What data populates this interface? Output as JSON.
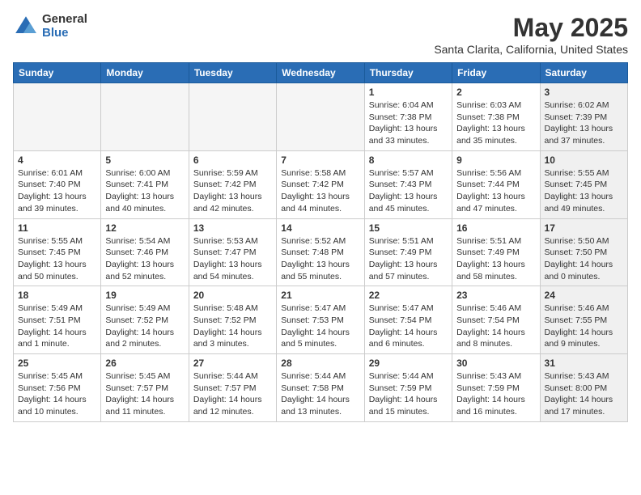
{
  "header": {
    "logo_general": "General",
    "logo_blue": "Blue",
    "month_title": "May 2025",
    "subtitle": "Santa Clarita, California, United States"
  },
  "days_of_week": [
    "Sunday",
    "Monday",
    "Tuesday",
    "Wednesday",
    "Thursday",
    "Friday",
    "Saturday"
  ],
  "weeks": [
    [
      {
        "day": "",
        "content": "",
        "shaded": true
      },
      {
        "day": "",
        "content": "",
        "shaded": true
      },
      {
        "day": "",
        "content": "",
        "shaded": true
      },
      {
        "day": "",
        "content": "",
        "shaded": true
      },
      {
        "day": "1",
        "content": "Sunrise: 6:04 AM\nSunset: 7:38 PM\nDaylight: 13 hours\nand 33 minutes.",
        "shaded": false
      },
      {
        "day": "2",
        "content": "Sunrise: 6:03 AM\nSunset: 7:38 PM\nDaylight: 13 hours\nand 35 minutes.",
        "shaded": false
      },
      {
        "day": "3",
        "content": "Sunrise: 6:02 AM\nSunset: 7:39 PM\nDaylight: 13 hours\nand 37 minutes.",
        "shaded": true
      }
    ],
    [
      {
        "day": "4",
        "content": "Sunrise: 6:01 AM\nSunset: 7:40 PM\nDaylight: 13 hours\nand 39 minutes.",
        "shaded": false
      },
      {
        "day": "5",
        "content": "Sunrise: 6:00 AM\nSunset: 7:41 PM\nDaylight: 13 hours\nand 40 minutes.",
        "shaded": false
      },
      {
        "day": "6",
        "content": "Sunrise: 5:59 AM\nSunset: 7:42 PM\nDaylight: 13 hours\nand 42 minutes.",
        "shaded": false
      },
      {
        "day": "7",
        "content": "Sunrise: 5:58 AM\nSunset: 7:42 PM\nDaylight: 13 hours\nand 44 minutes.",
        "shaded": false
      },
      {
        "day": "8",
        "content": "Sunrise: 5:57 AM\nSunset: 7:43 PM\nDaylight: 13 hours\nand 45 minutes.",
        "shaded": false
      },
      {
        "day": "9",
        "content": "Sunrise: 5:56 AM\nSunset: 7:44 PM\nDaylight: 13 hours\nand 47 minutes.",
        "shaded": false
      },
      {
        "day": "10",
        "content": "Sunrise: 5:55 AM\nSunset: 7:45 PM\nDaylight: 13 hours\nand 49 minutes.",
        "shaded": true
      }
    ],
    [
      {
        "day": "11",
        "content": "Sunrise: 5:55 AM\nSunset: 7:45 PM\nDaylight: 13 hours\nand 50 minutes.",
        "shaded": false
      },
      {
        "day": "12",
        "content": "Sunrise: 5:54 AM\nSunset: 7:46 PM\nDaylight: 13 hours\nand 52 minutes.",
        "shaded": false
      },
      {
        "day": "13",
        "content": "Sunrise: 5:53 AM\nSunset: 7:47 PM\nDaylight: 13 hours\nand 54 minutes.",
        "shaded": false
      },
      {
        "day": "14",
        "content": "Sunrise: 5:52 AM\nSunset: 7:48 PM\nDaylight: 13 hours\nand 55 minutes.",
        "shaded": false
      },
      {
        "day": "15",
        "content": "Sunrise: 5:51 AM\nSunset: 7:49 PM\nDaylight: 13 hours\nand 57 minutes.",
        "shaded": false
      },
      {
        "day": "16",
        "content": "Sunrise: 5:51 AM\nSunset: 7:49 PM\nDaylight: 13 hours\nand 58 minutes.",
        "shaded": false
      },
      {
        "day": "17",
        "content": "Sunrise: 5:50 AM\nSunset: 7:50 PM\nDaylight: 14 hours\nand 0 minutes.",
        "shaded": true
      }
    ],
    [
      {
        "day": "18",
        "content": "Sunrise: 5:49 AM\nSunset: 7:51 PM\nDaylight: 14 hours\nand 1 minute.",
        "shaded": false
      },
      {
        "day": "19",
        "content": "Sunrise: 5:49 AM\nSunset: 7:52 PM\nDaylight: 14 hours\nand 2 minutes.",
        "shaded": false
      },
      {
        "day": "20",
        "content": "Sunrise: 5:48 AM\nSunset: 7:52 PM\nDaylight: 14 hours\nand 3 minutes.",
        "shaded": false
      },
      {
        "day": "21",
        "content": "Sunrise: 5:47 AM\nSunset: 7:53 PM\nDaylight: 14 hours\nand 5 minutes.",
        "shaded": false
      },
      {
        "day": "22",
        "content": "Sunrise: 5:47 AM\nSunset: 7:54 PM\nDaylight: 14 hours\nand 6 minutes.",
        "shaded": false
      },
      {
        "day": "23",
        "content": "Sunrise: 5:46 AM\nSunset: 7:54 PM\nDaylight: 14 hours\nand 8 minutes.",
        "shaded": false
      },
      {
        "day": "24",
        "content": "Sunrise: 5:46 AM\nSunset: 7:55 PM\nDaylight: 14 hours\nand 9 minutes.",
        "shaded": true
      }
    ],
    [
      {
        "day": "25",
        "content": "Sunrise: 5:45 AM\nSunset: 7:56 PM\nDaylight: 14 hours\nand 10 minutes.",
        "shaded": false
      },
      {
        "day": "26",
        "content": "Sunrise: 5:45 AM\nSunset: 7:57 PM\nDaylight: 14 hours\nand 11 minutes.",
        "shaded": false
      },
      {
        "day": "27",
        "content": "Sunrise: 5:44 AM\nSunset: 7:57 PM\nDaylight: 14 hours\nand 12 minutes.",
        "shaded": false
      },
      {
        "day": "28",
        "content": "Sunrise: 5:44 AM\nSunset: 7:58 PM\nDaylight: 14 hours\nand 13 minutes.",
        "shaded": false
      },
      {
        "day": "29",
        "content": "Sunrise: 5:44 AM\nSunset: 7:59 PM\nDaylight: 14 hours\nand 15 minutes.",
        "shaded": false
      },
      {
        "day": "30",
        "content": "Sunrise: 5:43 AM\nSunset: 7:59 PM\nDaylight: 14 hours\nand 16 minutes.",
        "shaded": false
      },
      {
        "day": "31",
        "content": "Sunrise: 5:43 AM\nSunset: 8:00 PM\nDaylight: 14 hours\nand 17 minutes.",
        "shaded": true
      }
    ]
  ]
}
